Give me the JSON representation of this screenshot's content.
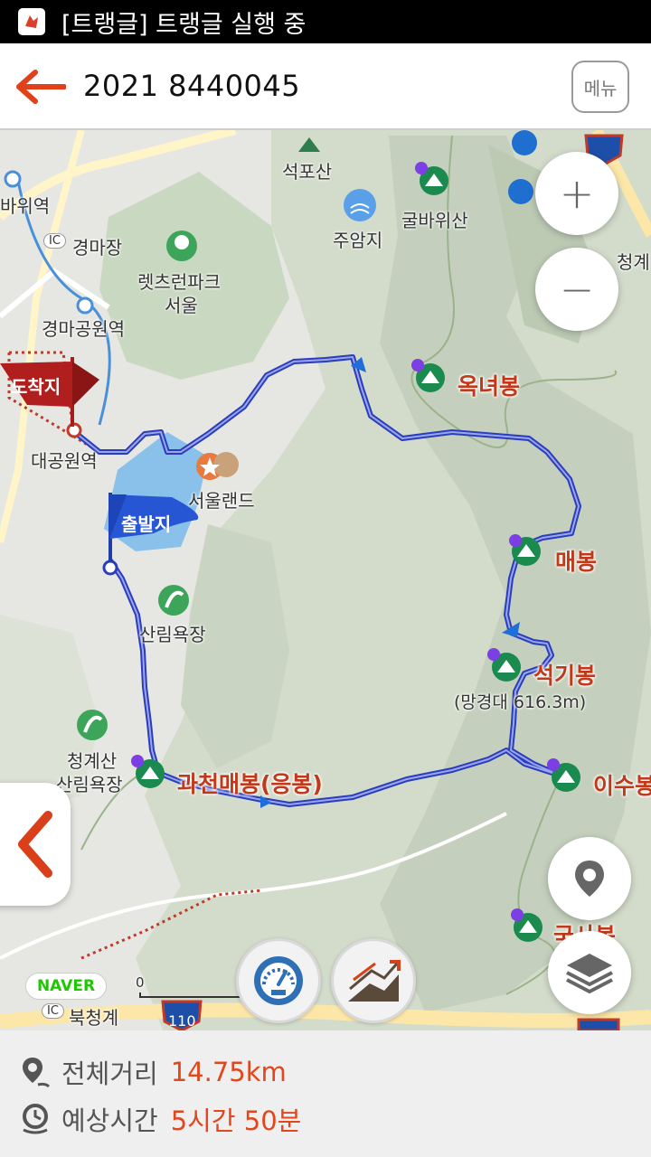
{
  "status_bar": {
    "title": "[트랭글] 트랭글 실행 중"
  },
  "header": {
    "back_icon": "arrow-left-icon",
    "title": "2021 8440045",
    "menu_label": "메뉴"
  },
  "map": {
    "places": {
      "seokposan": "석포산",
      "gulbawisan": "굴바위산",
      "juamji": "주암지",
      "cheongye": "청계",
      "bawiyeok": "바위역",
      "ic_badge": "IC",
      "gyeongmajang": "경마장",
      "letsrun_1": "렛츠런파크",
      "letsrun_2": "서울",
      "gyeongma_station": "경마공원역",
      "daegongwon_station": "대공원역",
      "seoulland": "서울랜드",
      "sallim_yokjang": "산림욕장",
      "cheonggyesan_1": "청계산",
      "cheonggyesan_2": "산림욕장",
      "mangyeongdae": "(망경대 616.3m)",
      "bukcheonggye": "북청계",
      "route_110": "110",
      "scale_zero": "0"
    },
    "peaks": {
      "oknyeobong": "옥녀봉",
      "maebong": "매봉",
      "seokgibong": "석기봉",
      "isubong": "이수봉",
      "gwacheon_maebong": "과천매봉(응봉)",
      "guksabong": "국사봉"
    },
    "flags": {
      "arrival": "도착지",
      "departure": "출발지"
    },
    "naver": "NAVER",
    "route_color": "#2b3dbd"
  },
  "controls": {
    "zoom_in": "+",
    "zoom_out": "−",
    "location_icon": "location-pin-icon",
    "layers_icon": "layers-icon",
    "collapse_icon": "chevron-left-icon",
    "speedometer_icon": "speedometer-icon",
    "elevation_icon": "elevation-graph-icon"
  },
  "summary": {
    "distance_label": "전체거리",
    "distance_value": "14.75km",
    "time_label": "예상시간",
    "time_value": "5시간 50분"
  }
}
